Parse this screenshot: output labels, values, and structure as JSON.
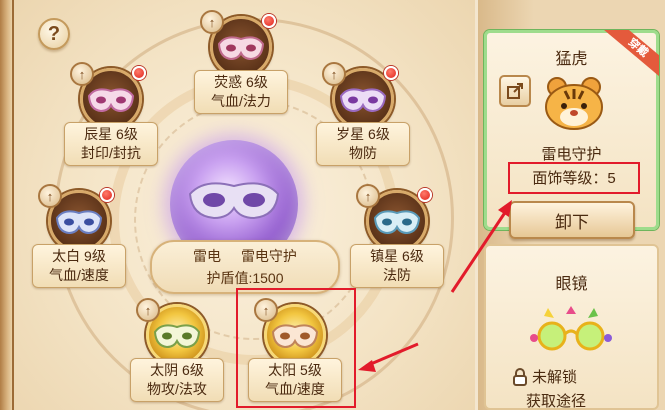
{
  "help": {
    "label": "?"
  },
  "center": {
    "name": "雷电",
    "item": "雷电守护",
    "shield": "护盾值:1500"
  },
  "slots": [
    {
      "name": "荧惑 6级",
      "attr": "气血/法力",
      "style": "dark",
      "red_dot": true
    },
    {
      "name": "辰星 6级",
      "attr": "封印/封抗",
      "style": "dark",
      "red_dot": true
    },
    {
      "name": "岁星 6级",
      "attr": "物防",
      "style": "dark",
      "red_dot": true
    },
    {
      "name": "太白 9级",
      "attr": "气血/速度",
      "style": "dark",
      "red_dot": true
    },
    {
      "name": "镇星 6级",
      "attr": "法防",
      "style": "dark",
      "red_dot": true
    },
    {
      "name": "太阴 6级",
      "attr": "物攻/法攻",
      "style": "gold",
      "red_dot": false
    },
    {
      "name": "太阳 5级",
      "attr": "气血/速度",
      "style": "gold",
      "red_dot": false
    }
  ],
  "slot_up_icon": "↑",
  "side": {
    "equipped": {
      "title": "猛虎",
      "ribbon": "穿戴",
      "item_name": "雷电守护",
      "level_text": "面饰等级：5",
      "button": "卸下"
    },
    "locked": {
      "title": "眼镜",
      "status": "未解锁",
      "obtain": "获取途径"
    }
  },
  "icons": {
    "help": "question-icon",
    "upgrade": "arrow-up-icon",
    "share": "share-icon",
    "lock": "lock-icon"
  },
  "colors": {
    "highlight": "#e21b2b",
    "active_border": "#9edc8c",
    "notify_dot": "#e0241c"
  }
}
